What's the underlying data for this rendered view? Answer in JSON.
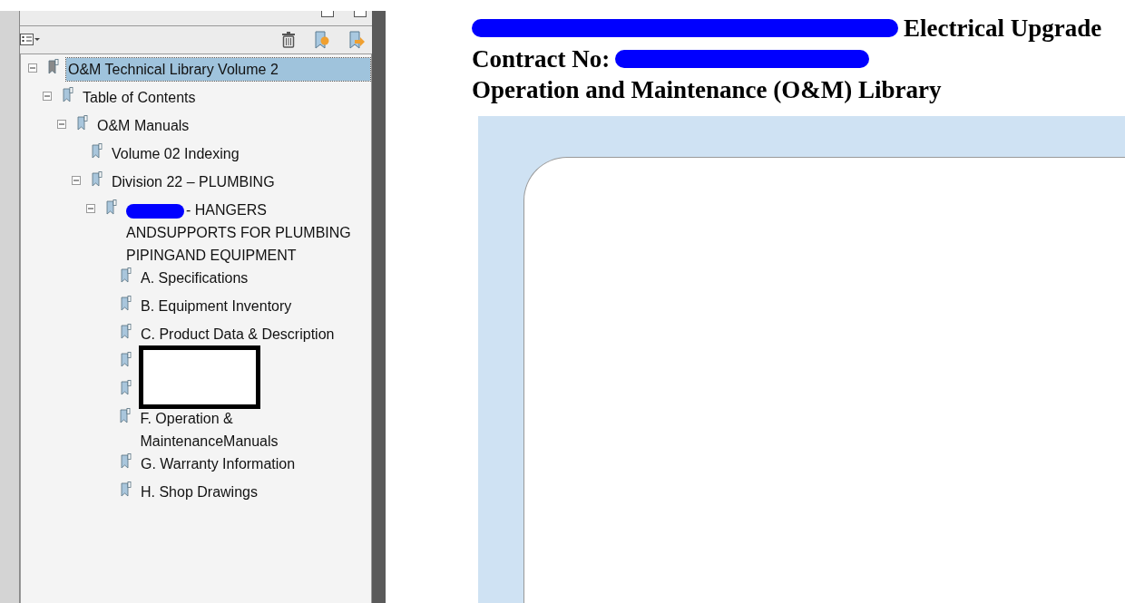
{
  "bookmarks": {
    "tree": [
      {
        "label": "O&M Technical Library Volume 2",
        "selected": true,
        "expanded": true,
        "children": [
          {
            "label": "Table of Contents",
            "selected": false,
            "expanded": true,
            "children": [
              {
                "label": "O&M Manuals",
                "selected": false,
                "expanded": true,
                "children": [
                  {
                    "label": "Volume 02 Indexing",
                    "selected": false
                  },
                  {
                    "label": "Division 22 – PLUMBING",
                    "selected": false,
                    "expanded": true,
                    "children": [
                      {
                        "label": "- HANGERS ANDSUPPORTS FOR PLUMBING PIPINGAND EQUIPMENT",
                        "redacted": true,
                        "selected": false,
                        "expanded": true,
                        "children": [
                          {
                            "label": "A. Specifications",
                            "selected": false
                          },
                          {
                            "label": "B. Equipment Inventory",
                            "selected": false
                          },
                          {
                            "label": "C. Product Data & Description",
                            "selected": false
                          },
                          {
                            "kind": "covered"
                          },
                          {
                            "kind": "covered"
                          },
                          {
                            "label": "F. Operation & MaintenanceManuals",
                            "selected": false
                          },
                          {
                            "label": "G. Warranty Information",
                            "selected": false
                          },
                          {
                            "label": "H. Shop Drawings",
                            "selected": false
                          }
                        ]
                      }
                    ]
                  }
                ]
              }
            ]
          }
        ]
      }
    ]
  },
  "document": {
    "lines": [
      {
        "text": "Electrical Upgrade",
        "redacted_before": true
      },
      {
        "text": "Contract No:",
        "redacted_after": true
      },
      {
        "text": "Operation and Maintenance (O&M) Library"
      }
    ]
  }
}
